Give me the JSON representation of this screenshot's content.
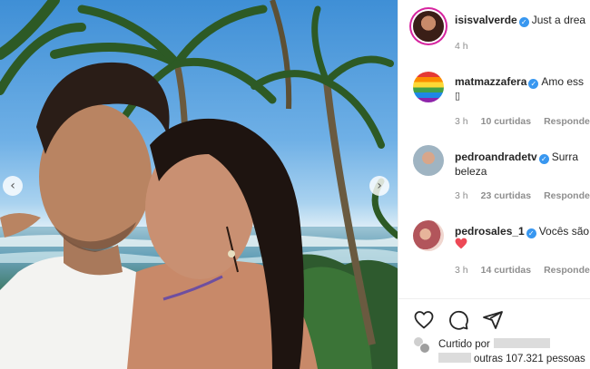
{
  "post": {
    "author": "isisvalverde",
    "caption": "Just a drea",
    "time": "4 h"
  },
  "comments": [
    {
      "user": "matmazzafera",
      "text": "Amo ess",
      "text_line2": "▯",
      "time": "3 h",
      "likes": "10 curtidas",
      "reply": "Responder"
    },
    {
      "user": "pedroandradetv",
      "text": "Surra",
      "text_line2": "beleza",
      "time": "3 h",
      "likes": "23 curtidas",
      "reply": "Responder"
    },
    {
      "user": "pedrosales_1",
      "text": "Vocês são",
      "time": "3 h",
      "likes": "14 curtidas",
      "reply": "Responder"
    }
  ],
  "carousel": {
    "prev_icon": "‹",
    "next_icon": "›"
  },
  "verified_icon": "✓",
  "likes": {
    "line1_prefix": "Curtido por",
    "line2": "outras 107.321 pessoas"
  },
  "colors": {
    "verified": "#3897f0",
    "heart": "#ed4956",
    "story_ring": "#d6249f"
  }
}
